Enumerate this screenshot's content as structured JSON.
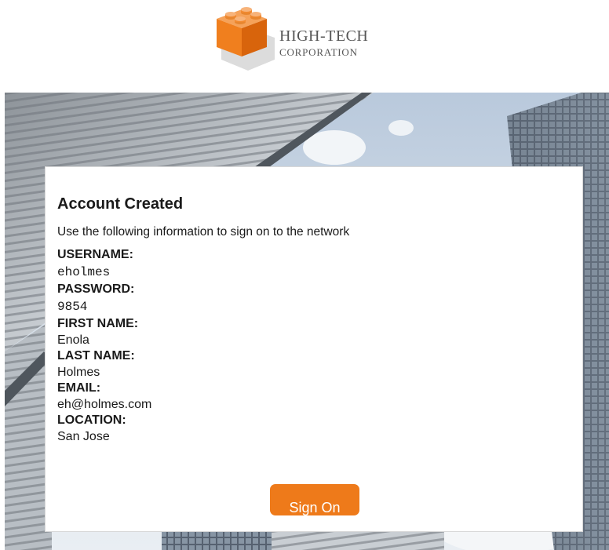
{
  "brand": {
    "name_line1": "HIGH-TECH",
    "name_line2": "CORPORATION",
    "logo_icon": "orange-brick-cube-icon",
    "accent_color": "#ee7a1a"
  },
  "card": {
    "title": "Account Created",
    "subtitle": "Use the following information to sign on to the network",
    "fields": [
      {
        "label": "USERNAME:",
        "value": "eholmes"
      },
      {
        "label": "PASSWORD:",
        "value": "9854"
      },
      {
        "label": "FIRST NAME:",
        "value": "Enola"
      },
      {
        "label": "LAST NAME:",
        "value": "Holmes"
      },
      {
        "label": "EMAIL:",
        "value": "eh@holmes.com"
      },
      {
        "label": "LOCATION:",
        "value": "San Jose"
      }
    ],
    "button_label": "Sign On"
  }
}
